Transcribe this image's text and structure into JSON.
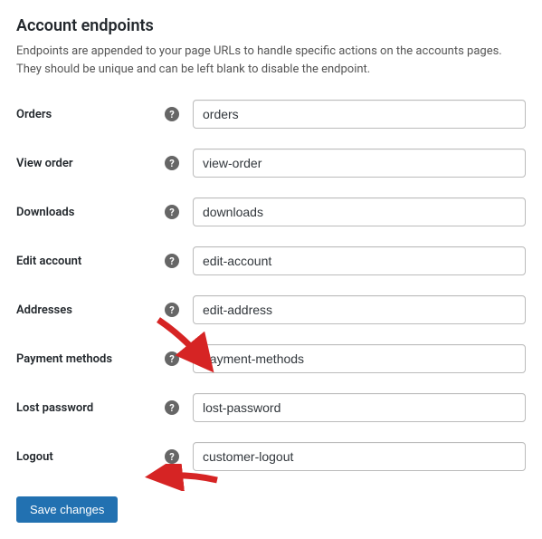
{
  "section": {
    "title": "Account endpoints",
    "description": "Endpoints are appended to your page URLs to handle specific actions on the accounts pages. They should be unique and can be left blank to disable the endpoint."
  },
  "fields": {
    "orders": {
      "label": "Orders",
      "value": "orders"
    },
    "view_order": {
      "label": "View order",
      "value": "view-order"
    },
    "downloads": {
      "label": "Downloads",
      "value": "downloads"
    },
    "edit_account": {
      "label": "Edit account",
      "value": "edit-account"
    },
    "addresses": {
      "label": "Addresses",
      "value": "edit-address"
    },
    "payment_methods": {
      "label": "Payment methods",
      "value": "payment-methods"
    },
    "lost_password": {
      "label": "Lost password",
      "value": "lost-password"
    },
    "logout": {
      "label": "Logout",
      "value": "customer-logout"
    }
  },
  "buttons": {
    "save": "Save changes"
  },
  "annotations": {
    "arrow_color": "#d62424"
  }
}
